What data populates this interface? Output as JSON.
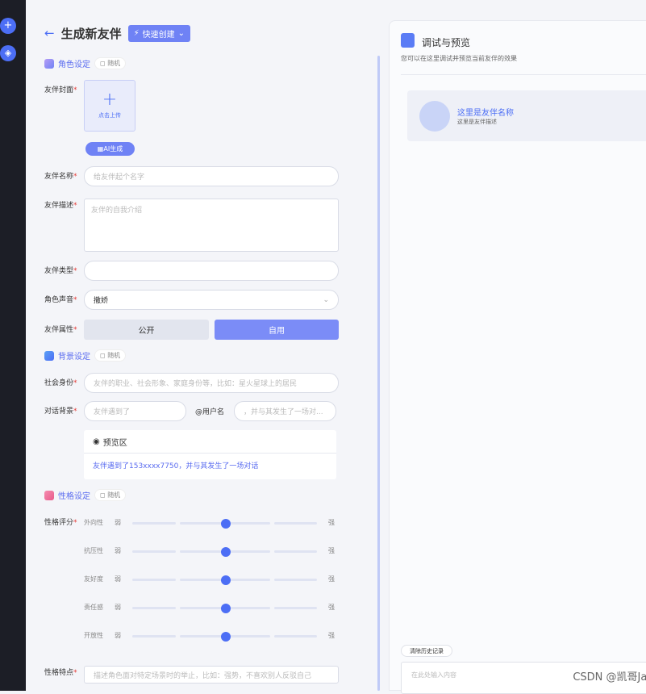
{
  "header": {
    "title": "生成新友伴",
    "quick_create": "快速创建"
  },
  "sections": {
    "role": {
      "title": "角色设定",
      "random": "随机"
    },
    "background": {
      "title": "背景设定",
      "random": "随机"
    },
    "personality": {
      "title": "性格设定",
      "random": "随机"
    }
  },
  "form": {
    "cover_label": "友伴封面",
    "upload_text": "点击上传",
    "ai_generate": "AI生成",
    "name_label": "友伴名称",
    "name_placeholder": "给友伴起个名字",
    "desc_label": "友伴描述",
    "desc_placeholder": "友伴的自我介绍",
    "type_label": "友伴类型",
    "voice_label": "角色声音",
    "voice_value": "撒娇",
    "attr_label": "友伴属性",
    "attr_public": "公开",
    "attr_private": "自用",
    "identity_label": "社会身份",
    "identity_placeholder": "友伴的职业、社会形象、家庭身份等，比如：星火星球上的居民",
    "dialog_label": "对话背景",
    "dialog_placeholder1": "友伴遇到了",
    "user_tag": "@用户名",
    "dialog_placeholder2": "，并与其发生了一场对...",
    "preview_title": "预览区",
    "preview_text": "友伴遇到了153xxxx7750，并与其发生了一场对话",
    "score_label": "性格评分",
    "traits_label": "性格特点",
    "traits_placeholder": "描述角色面对特定场景时的举止，比如：强势，不喜欢别人反驳自己"
  },
  "sliders": [
    {
      "name": "外向性",
      "weak": "弱",
      "strong": "强",
      "value": 0.5
    },
    {
      "name": "抗压性",
      "weak": "弱",
      "strong": "强",
      "value": 0.5
    },
    {
      "name": "友好度",
      "weak": "弱",
      "strong": "强",
      "value": 0.5
    },
    {
      "name": "责任感",
      "weak": "弱",
      "strong": "强",
      "value": 0.5
    },
    {
      "name": "开放性",
      "weak": "弱",
      "strong": "强",
      "value": 0.5
    }
  ],
  "right": {
    "title": "调试与预览",
    "subtitle": "您可以在这里调试并预览当前友伴的效果",
    "companion_name": "这里是友伴名称",
    "companion_desc": "这里是友伴描述",
    "clear_history": "清除历史记录",
    "chat_placeholder": "在此处输入内容"
  },
  "watermark": "CSDN @凯哥Java",
  "colors": {
    "accent": "#4c6ef5",
    "accent_light": "#6f82f5",
    "required": "#e53935"
  }
}
